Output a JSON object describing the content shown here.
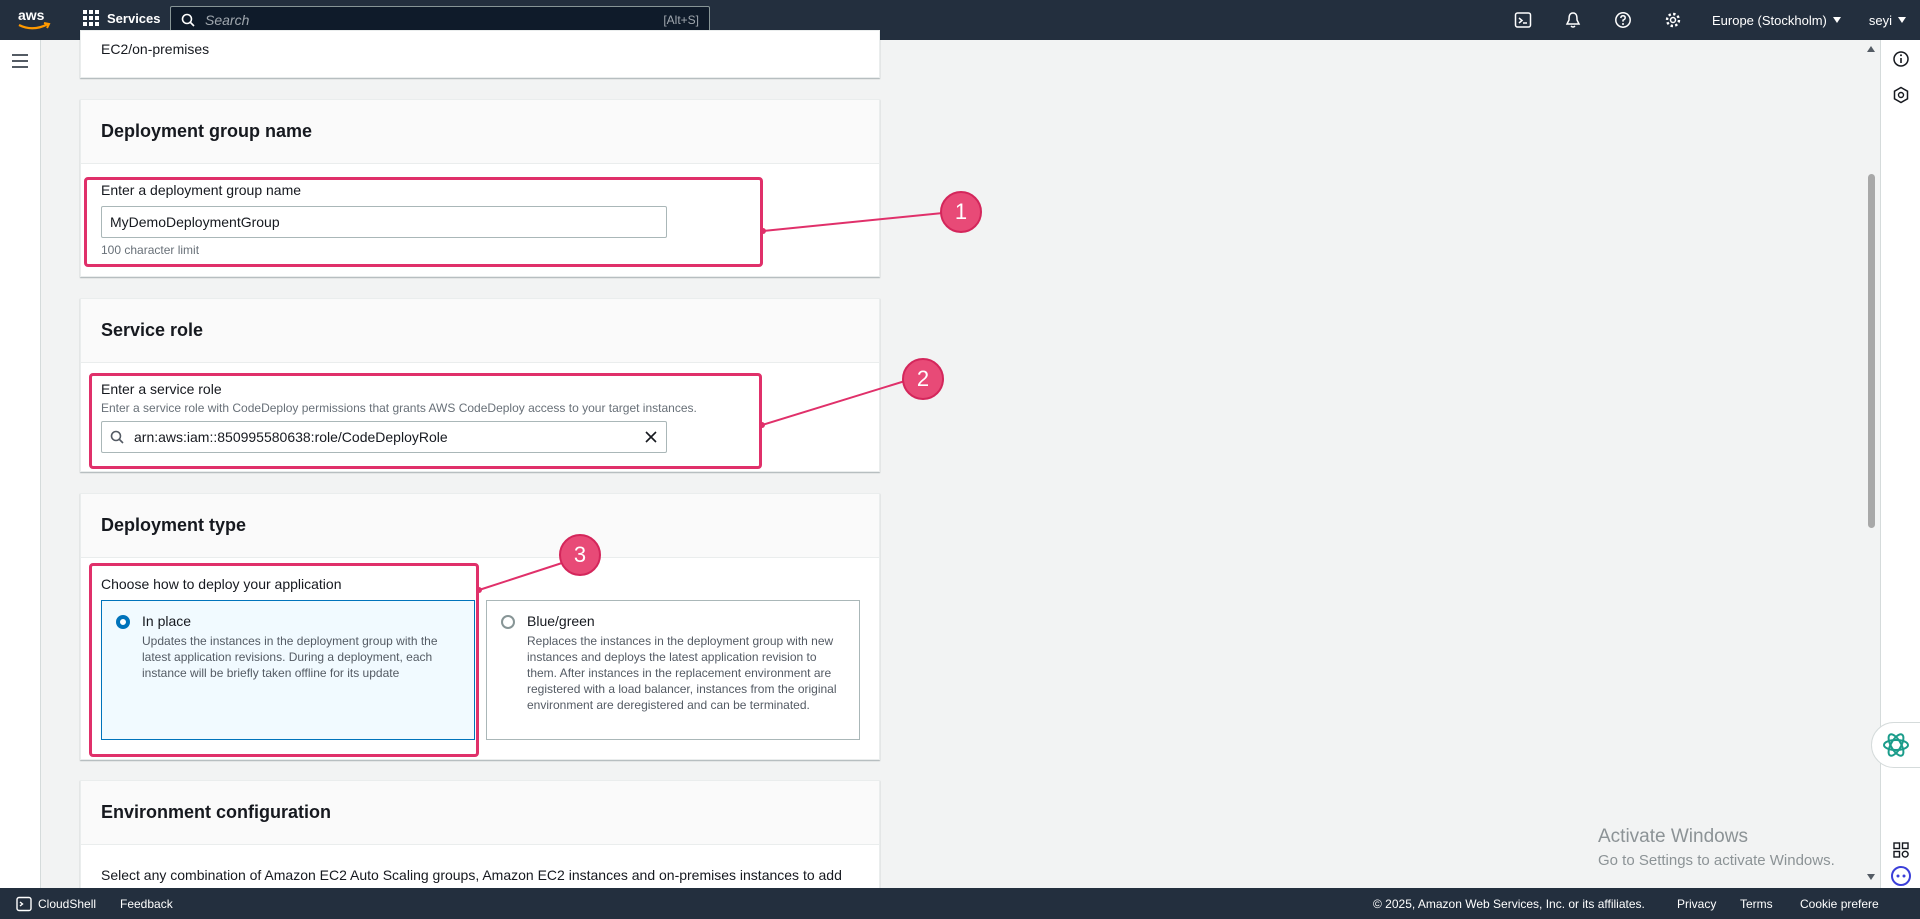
{
  "topnav": {
    "logo_text": "aws",
    "services_label": "Services",
    "search_placeholder": "Search",
    "search_shortcut": "[Alt+S]",
    "region": "Europe (Stockholm)",
    "user": "seyi"
  },
  "page": {
    "top_fragment": "EC2/on-premises",
    "deployment_group": {
      "title": "Deployment group name",
      "field_label": "Enter a deployment group name",
      "value": "MyDemoDeploymentGroup",
      "hint": "100 character limit"
    },
    "service_role": {
      "title": "Service role",
      "field_label": "Enter a service role",
      "description": "Enter a service role with CodeDeploy permissions that grants AWS CodeDeploy access to your target instances.",
      "value": "arn:aws:iam::850995580638:role/CodeDeployRole"
    },
    "deployment_type": {
      "title": "Deployment type",
      "field_label": "Choose how to deploy your application",
      "options": [
        {
          "label": "In place",
          "description": "Updates the instances in the deployment group with the latest application revisions. During a deployment, each instance will be briefly taken offline for its update",
          "selected": true
        },
        {
          "label": "Blue/green",
          "description": "Replaces the instances in the deployment group with new instances and deploys the latest application revision to them. After instances in the replacement environment are registered with a load balancer, instances from the original environment are deregistered and can be terminated.",
          "selected": false
        }
      ]
    },
    "environment": {
      "title": "Environment configuration",
      "description": "Select any combination of Amazon EC2 Auto Scaling groups, Amazon EC2 instances and on-premises instances to add"
    }
  },
  "annotations": {
    "one": "1",
    "two": "2",
    "three": "3"
  },
  "watermark": {
    "line1": "Activate Windows",
    "line2": "Go to Settings to activate Windows."
  },
  "footer": {
    "cloudshell": "CloudShell",
    "feedback": "Feedback",
    "copyright": "© 2025, Amazon Web Services, Inc. or its affiliates.",
    "privacy": "Privacy",
    "terms": "Terms",
    "cookie": "Cookie prefere"
  },
  "colors": {
    "nav": "#232f3e",
    "highlight": "#e0306a",
    "selected": "#0073bb"
  }
}
